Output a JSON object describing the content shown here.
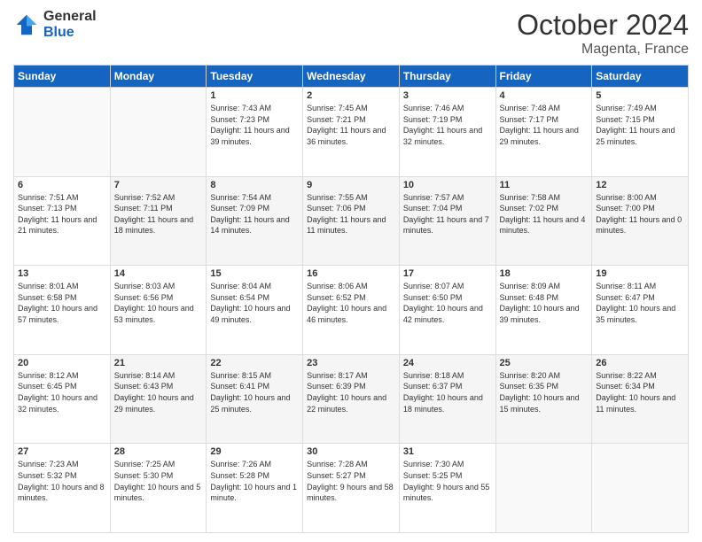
{
  "header": {
    "logo": {
      "general": "General",
      "blue": "Blue"
    },
    "title": "October 2024",
    "location": "Magenta, France"
  },
  "days_of_week": [
    "Sunday",
    "Monday",
    "Tuesday",
    "Wednesday",
    "Thursday",
    "Friday",
    "Saturday"
  ],
  "weeks": [
    [
      {
        "day": "",
        "sunrise": "",
        "sunset": "",
        "daylight": ""
      },
      {
        "day": "",
        "sunrise": "",
        "sunset": "",
        "daylight": ""
      },
      {
        "day": "1",
        "sunrise": "Sunrise: 7:43 AM",
        "sunset": "Sunset: 7:23 PM",
        "daylight": "Daylight: 11 hours and 39 minutes."
      },
      {
        "day": "2",
        "sunrise": "Sunrise: 7:45 AM",
        "sunset": "Sunset: 7:21 PM",
        "daylight": "Daylight: 11 hours and 36 minutes."
      },
      {
        "day": "3",
        "sunrise": "Sunrise: 7:46 AM",
        "sunset": "Sunset: 7:19 PM",
        "daylight": "Daylight: 11 hours and 32 minutes."
      },
      {
        "day": "4",
        "sunrise": "Sunrise: 7:48 AM",
        "sunset": "Sunset: 7:17 PM",
        "daylight": "Daylight: 11 hours and 29 minutes."
      },
      {
        "day": "5",
        "sunrise": "Sunrise: 7:49 AM",
        "sunset": "Sunset: 7:15 PM",
        "daylight": "Daylight: 11 hours and 25 minutes."
      }
    ],
    [
      {
        "day": "6",
        "sunrise": "Sunrise: 7:51 AM",
        "sunset": "Sunset: 7:13 PM",
        "daylight": "Daylight: 11 hours and 21 minutes."
      },
      {
        "day": "7",
        "sunrise": "Sunrise: 7:52 AM",
        "sunset": "Sunset: 7:11 PM",
        "daylight": "Daylight: 11 hours and 18 minutes."
      },
      {
        "day": "8",
        "sunrise": "Sunrise: 7:54 AM",
        "sunset": "Sunset: 7:09 PM",
        "daylight": "Daylight: 11 hours and 14 minutes."
      },
      {
        "day": "9",
        "sunrise": "Sunrise: 7:55 AM",
        "sunset": "Sunset: 7:06 PM",
        "daylight": "Daylight: 11 hours and 11 minutes."
      },
      {
        "day": "10",
        "sunrise": "Sunrise: 7:57 AM",
        "sunset": "Sunset: 7:04 PM",
        "daylight": "Daylight: 11 hours and 7 minutes."
      },
      {
        "day": "11",
        "sunrise": "Sunrise: 7:58 AM",
        "sunset": "Sunset: 7:02 PM",
        "daylight": "Daylight: 11 hours and 4 minutes."
      },
      {
        "day": "12",
        "sunrise": "Sunrise: 8:00 AM",
        "sunset": "Sunset: 7:00 PM",
        "daylight": "Daylight: 11 hours and 0 minutes."
      }
    ],
    [
      {
        "day": "13",
        "sunrise": "Sunrise: 8:01 AM",
        "sunset": "Sunset: 6:58 PM",
        "daylight": "Daylight: 10 hours and 57 minutes."
      },
      {
        "day": "14",
        "sunrise": "Sunrise: 8:03 AM",
        "sunset": "Sunset: 6:56 PM",
        "daylight": "Daylight: 10 hours and 53 minutes."
      },
      {
        "day": "15",
        "sunrise": "Sunrise: 8:04 AM",
        "sunset": "Sunset: 6:54 PM",
        "daylight": "Daylight: 10 hours and 49 minutes."
      },
      {
        "day": "16",
        "sunrise": "Sunrise: 8:06 AM",
        "sunset": "Sunset: 6:52 PM",
        "daylight": "Daylight: 10 hours and 46 minutes."
      },
      {
        "day": "17",
        "sunrise": "Sunrise: 8:07 AM",
        "sunset": "Sunset: 6:50 PM",
        "daylight": "Daylight: 10 hours and 42 minutes."
      },
      {
        "day": "18",
        "sunrise": "Sunrise: 8:09 AM",
        "sunset": "Sunset: 6:48 PM",
        "daylight": "Daylight: 10 hours and 39 minutes."
      },
      {
        "day": "19",
        "sunrise": "Sunrise: 8:11 AM",
        "sunset": "Sunset: 6:47 PM",
        "daylight": "Daylight: 10 hours and 35 minutes."
      }
    ],
    [
      {
        "day": "20",
        "sunrise": "Sunrise: 8:12 AM",
        "sunset": "Sunset: 6:45 PM",
        "daylight": "Daylight: 10 hours and 32 minutes."
      },
      {
        "day": "21",
        "sunrise": "Sunrise: 8:14 AM",
        "sunset": "Sunset: 6:43 PM",
        "daylight": "Daylight: 10 hours and 29 minutes."
      },
      {
        "day": "22",
        "sunrise": "Sunrise: 8:15 AM",
        "sunset": "Sunset: 6:41 PM",
        "daylight": "Daylight: 10 hours and 25 minutes."
      },
      {
        "day": "23",
        "sunrise": "Sunrise: 8:17 AM",
        "sunset": "Sunset: 6:39 PM",
        "daylight": "Daylight: 10 hours and 22 minutes."
      },
      {
        "day": "24",
        "sunrise": "Sunrise: 8:18 AM",
        "sunset": "Sunset: 6:37 PM",
        "daylight": "Daylight: 10 hours and 18 minutes."
      },
      {
        "day": "25",
        "sunrise": "Sunrise: 8:20 AM",
        "sunset": "Sunset: 6:35 PM",
        "daylight": "Daylight: 10 hours and 15 minutes."
      },
      {
        "day": "26",
        "sunrise": "Sunrise: 8:22 AM",
        "sunset": "Sunset: 6:34 PM",
        "daylight": "Daylight: 10 hours and 11 minutes."
      }
    ],
    [
      {
        "day": "27",
        "sunrise": "Sunrise: 7:23 AM",
        "sunset": "Sunset: 5:32 PM",
        "daylight": "Daylight: 10 hours and 8 minutes."
      },
      {
        "day": "28",
        "sunrise": "Sunrise: 7:25 AM",
        "sunset": "Sunset: 5:30 PM",
        "daylight": "Daylight: 10 hours and 5 minutes."
      },
      {
        "day": "29",
        "sunrise": "Sunrise: 7:26 AM",
        "sunset": "Sunset: 5:28 PM",
        "daylight": "Daylight: 10 hours and 1 minute."
      },
      {
        "day": "30",
        "sunrise": "Sunrise: 7:28 AM",
        "sunset": "Sunset: 5:27 PM",
        "daylight": "Daylight: 9 hours and 58 minutes."
      },
      {
        "day": "31",
        "sunrise": "Sunrise: 7:30 AM",
        "sunset": "Sunset: 5:25 PM",
        "daylight": "Daylight: 9 hours and 55 minutes."
      },
      {
        "day": "",
        "sunrise": "",
        "sunset": "",
        "daylight": ""
      },
      {
        "day": "",
        "sunrise": "",
        "sunset": "",
        "daylight": ""
      }
    ]
  ]
}
